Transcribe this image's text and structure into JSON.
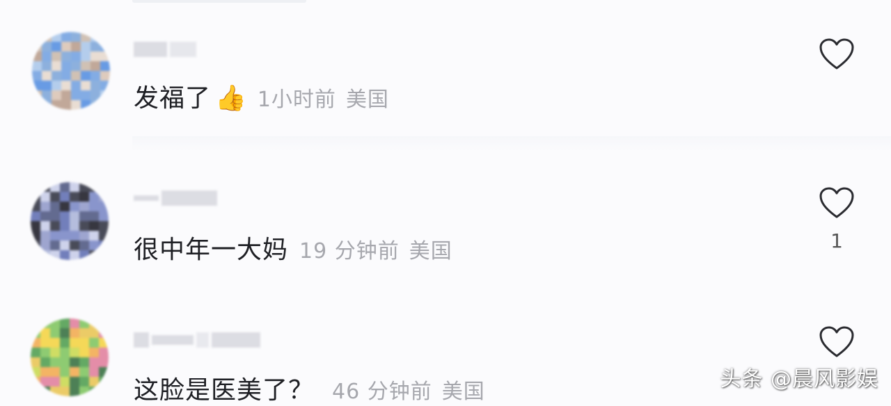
{
  "comments": [
    {
      "text": "发福了",
      "emoji": "👍",
      "time": "1小时前",
      "location": "美国",
      "like_count": ""
    },
    {
      "text": "很中年一大妈",
      "time": "19 分钟前",
      "location": "美国",
      "like_count": "1"
    },
    {
      "text": "这脸是医美了？",
      "time": "46 分钟前",
      "location": "美国",
      "like_count": ""
    }
  ],
  "watermark": "头条 @晨风影娱",
  "icons": {
    "like": "heart-outline-icon",
    "reaction": "thumbs-up-emoji"
  },
  "colors": {
    "text": "#1e1f24",
    "meta": "#a6a7ad",
    "icon": "#2a2b30",
    "background": "#fbfbfd"
  }
}
